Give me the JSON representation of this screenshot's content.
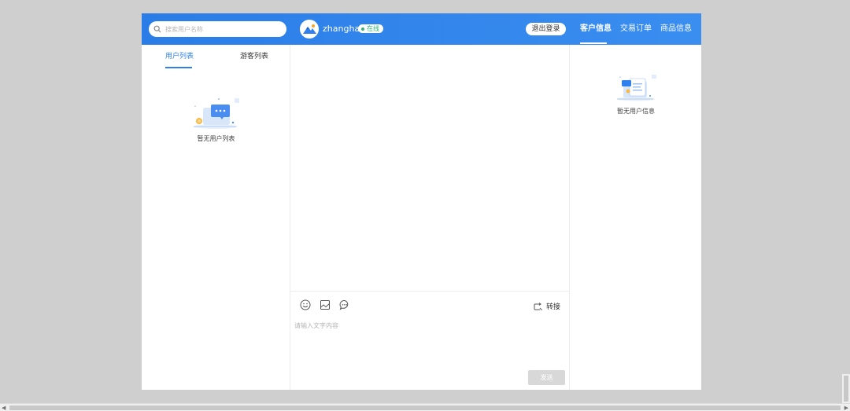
{
  "header": {
    "search_placeholder": "搜索用户名称",
    "username": "zhanghao",
    "status": "在线",
    "logout": "退出登录",
    "tabs": [
      "客户信息",
      "交易订单",
      "商品信息"
    ],
    "active_tab": "客户信息"
  },
  "left_panel": {
    "tabs": [
      "用户列表",
      "游客列表"
    ],
    "active_tab": "用户列表",
    "empty_text": "暂无用户列表"
  },
  "chat": {
    "tools": [
      "emoji-icon",
      "image-icon",
      "quick-reply-icon"
    ],
    "transfer_label": "转接",
    "input_placeholder": "请输入文字内容",
    "send_label": "发送"
  },
  "right_panel": {
    "empty_text": "暂无用户信息"
  },
  "colors": {
    "header_bg": "#2f80ed",
    "accent": "#2f80ed",
    "online": "#2bb673",
    "send_disabled": "#d8d8d8"
  }
}
